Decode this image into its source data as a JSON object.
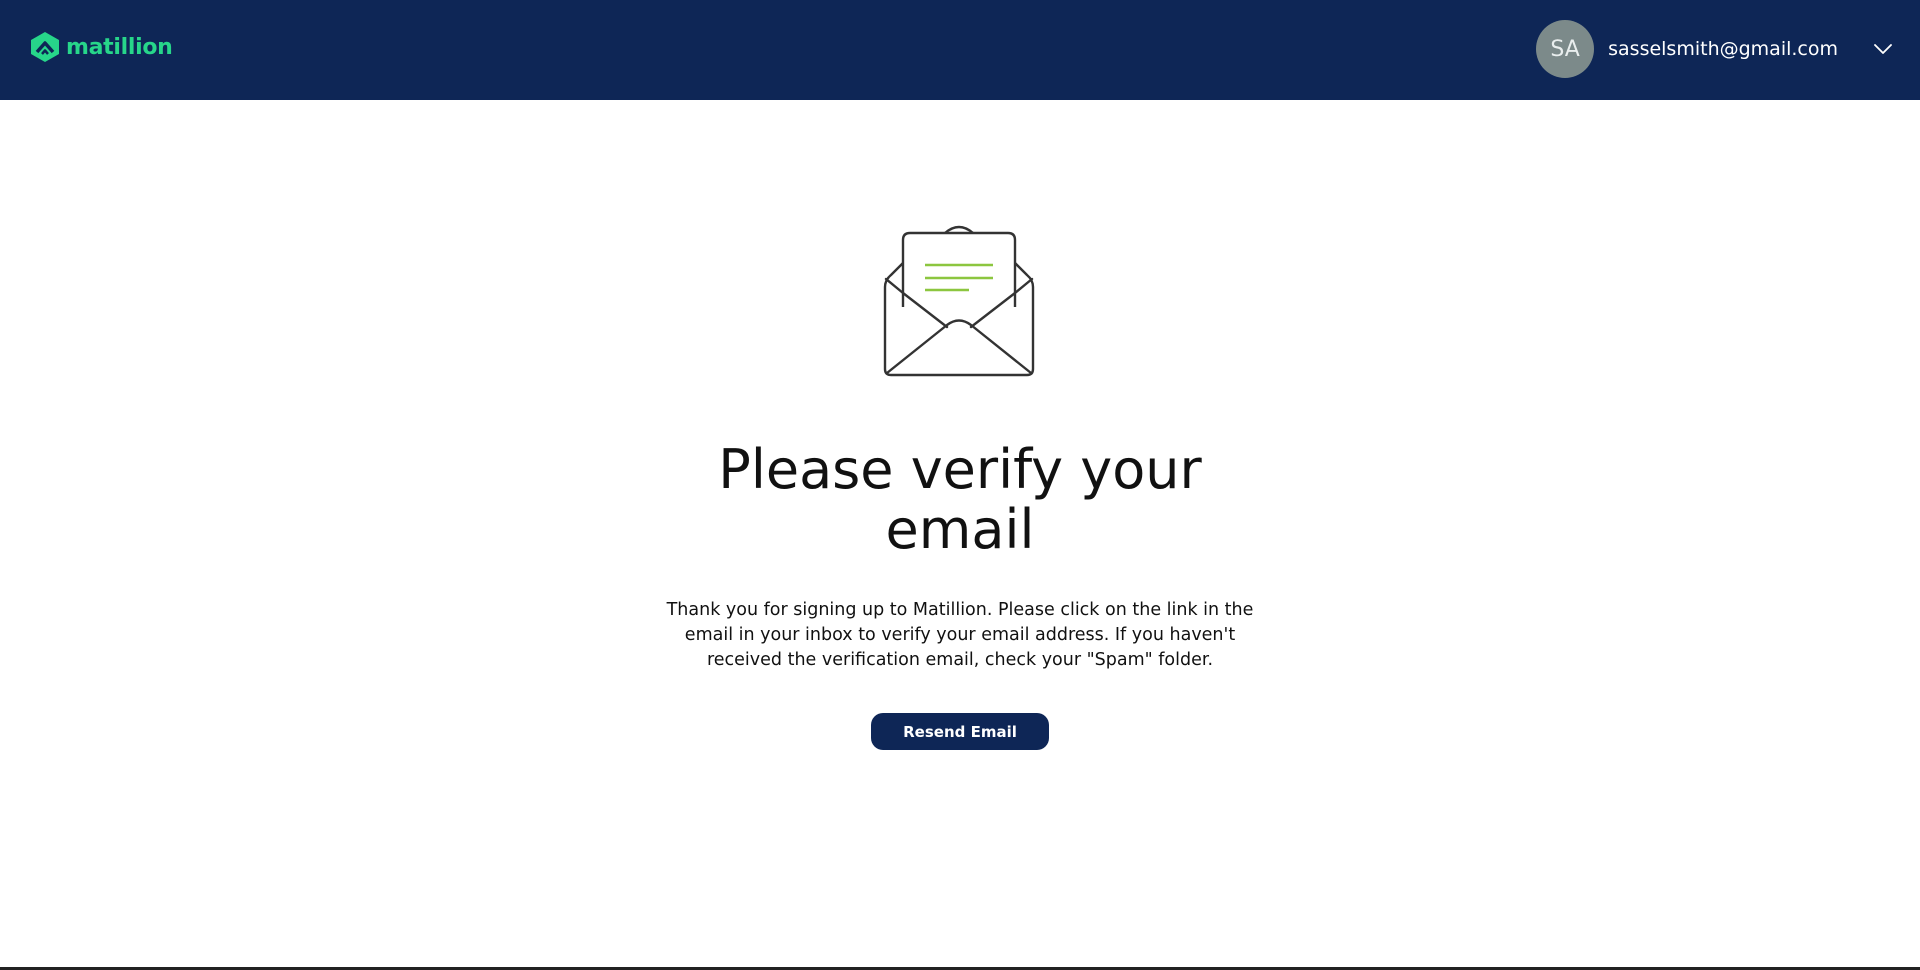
{
  "header": {
    "logo_text": "matillion",
    "logo_icon": "matillion-logo-icon",
    "user": {
      "initials": "SA",
      "email": "sasselsmith@gmail.com",
      "menu_icon": "chevron-down-icon"
    }
  },
  "main": {
    "illustration_icon": "open-envelope-icon",
    "title_line1": "Please verify your",
    "title_line2": "email",
    "message_line1": "Thank you for signing up to Matillion. Please click on the link in the",
    "message_line2": "email in your inbox to verify your email address. If you haven't",
    "message_line3": "received the verification email, check your \"Spam\" folder.",
    "resend_label": "Resend Email"
  },
  "colors": {
    "header_bg": "#0e2656",
    "brand_green": "#27d68a",
    "letter_lines": "#8cc63f",
    "avatar_bg": "#7c8a8a",
    "button_bg": "#0e2656"
  }
}
